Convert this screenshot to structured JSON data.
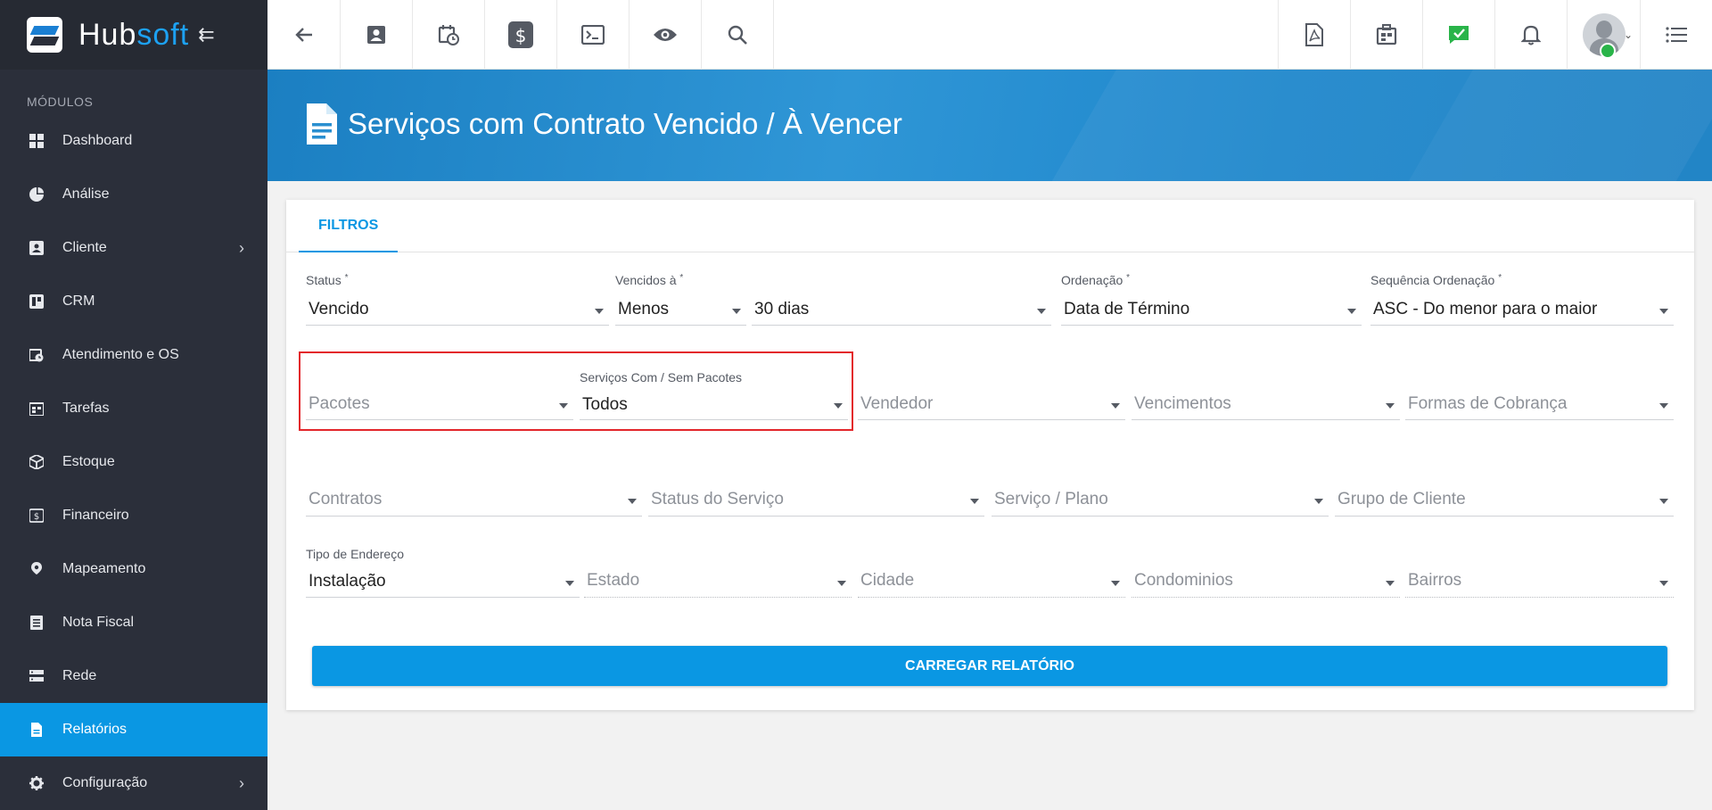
{
  "brand": {
    "name_a": "Hub",
    "name_b": "soft"
  },
  "sidebar": {
    "section_label": "MÓDULOS",
    "items": [
      {
        "label": "Dashboard",
        "icon": "dashboard-icon"
      },
      {
        "label": "Análise",
        "icon": "pie-chart-icon"
      },
      {
        "label": "Cliente",
        "icon": "contact-card-icon",
        "has_submenu": true
      },
      {
        "label": "CRM",
        "icon": "kanban-icon"
      },
      {
        "label": "Atendimento e OS",
        "icon": "calendar-clock-icon"
      },
      {
        "label": "Tarefas",
        "icon": "tasks-icon"
      },
      {
        "label": "Estoque",
        "icon": "box-icon"
      },
      {
        "label": "Financeiro",
        "icon": "dollar-icon"
      },
      {
        "label": "Mapeamento",
        "icon": "map-pin-icon"
      },
      {
        "label": "Nota Fiscal",
        "icon": "receipt-icon"
      },
      {
        "label": "Rede",
        "icon": "server-icon"
      },
      {
        "label": "Relatórios",
        "icon": "document-icon",
        "active": true
      },
      {
        "label": "Configuração",
        "icon": "gear-icon",
        "has_submenu": true
      }
    ]
  },
  "header": {
    "title": "Serviços com Contrato Vencido / À Vencer"
  },
  "tabs": [
    {
      "label": "FILTROS",
      "active": true
    }
  ],
  "filters": {
    "status": {
      "label": "Status",
      "required": "*",
      "value": "Vencido"
    },
    "vencidos_a": {
      "label": "Vencidos à",
      "required": "*",
      "value": "Menos"
    },
    "dias": {
      "value": "30 dias"
    },
    "ordenacao": {
      "label": "Ordenação",
      "required": "*",
      "value": "Data de Término"
    },
    "sequencia": {
      "label": "Sequência Ordenação",
      "required": "*",
      "value": "ASC - Do menor para o maior"
    },
    "pacotes": {
      "placeholder": "Pacotes"
    },
    "servicos_pacotes": {
      "label": "Serviços Com / Sem Pacotes",
      "value": "Todos"
    },
    "vendedor": {
      "placeholder": "Vendedor"
    },
    "vencimentos": {
      "placeholder": "Vencimentos"
    },
    "formas_cobranca": {
      "placeholder": "Formas de Cobrança"
    },
    "contratos": {
      "placeholder": "Contratos"
    },
    "status_servico": {
      "placeholder": "Status do Serviço"
    },
    "servico_plano": {
      "placeholder": "Serviço / Plano"
    },
    "grupo_cliente": {
      "placeholder": "Grupo de Cliente"
    },
    "tipo_endereco": {
      "label": "Tipo de Endereço",
      "value": "Instalação"
    },
    "estado": {
      "placeholder": "Estado"
    },
    "cidade": {
      "placeholder": "Cidade"
    },
    "condominios": {
      "placeholder": "Condominios"
    },
    "bairros": {
      "placeholder": "Bairros"
    }
  },
  "actions": {
    "load_report": "CARREGAR RELATÓRIO"
  },
  "colors": {
    "accent": "#0a97e3",
    "sidebar_bg": "#2b2f3a",
    "highlight": "#e3262b",
    "status_online": "#29b449"
  }
}
